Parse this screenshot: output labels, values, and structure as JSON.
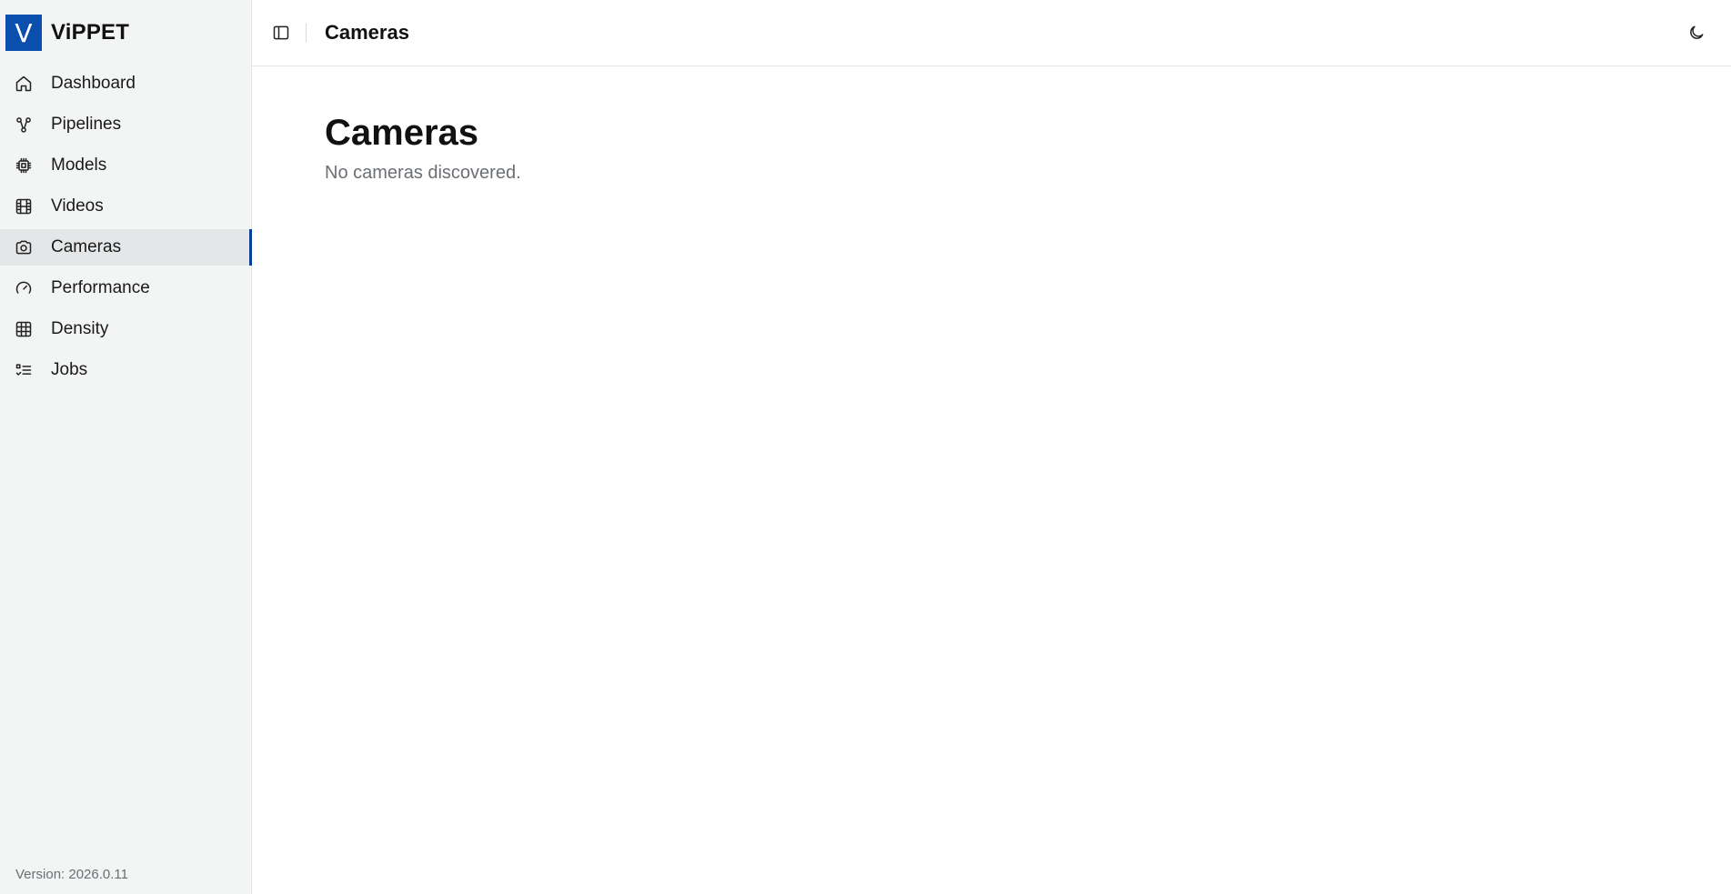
{
  "brand": {
    "logo_letter": "V",
    "name": "ViPPET",
    "color": "#0a4fae"
  },
  "sidebar": {
    "items": [
      {
        "label": "Dashboard",
        "icon": "home-icon"
      },
      {
        "label": "Pipelines",
        "icon": "pipeline-icon"
      },
      {
        "label": "Models",
        "icon": "chip-icon"
      },
      {
        "label": "Videos",
        "icon": "film-icon"
      },
      {
        "label": "Cameras",
        "icon": "camera-icon",
        "active": true
      },
      {
        "label": "Performance",
        "icon": "gauge-icon"
      },
      {
        "label": "Density",
        "icon": "grid-icon"
      },
      {
        "label": "Jobs",
        "icon": "list-check-icon"
      }
    ],
    "version": "Version: 2026.0.11"
  },
  "header": {
    "title": "Cameras"
  },
  "main": {
    "title": "Cameras",
    "empty_message": "No cameras discovered."
  }
}
